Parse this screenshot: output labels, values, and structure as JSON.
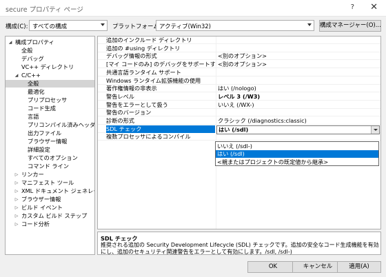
{
  "window": {
    "title": "secure プロパティ ページ",
    "help": "?",
    "close": "✕"
  },
  "toolbar": {
    "config_label": "構成(C):",
    "config_value": "すべての構成",
    "platform_label": "プラットフォーム(P):",
    "platform_value": "アクティブ(Win32)",
    "config_manager": "構成マネージャー(O)..."
  },
  "tree": [
    {
      "label": "構成プロパティ",
      "level": 0,
      "expander": "◢"
    },
    {
      "label": "全般",
      "level": 1
    },
    {
      "label": "デバッグ",
      "level": 1
    },
    {
      "label": "VC++ ディレクトリ",
      "level": 1
    },
    {
      "label": "C/C++",
      "level": 1,
      "expander": "◢"
    },
    {
      "label": "全般",
      "level": 2,
      "selected": true
    },
    {
      "label": "最適化",
      "level": 2
    },
    {
      "label": "プリプロセッサ",
      "level": 2
    },
    {
      "label": "コード生成",
      "level": 2
    },
    {
      "label": "言語",
      "level": 2
    },
    {
      "label": "プリコンパイル済みヘッダー",
      "level": 2
    },
    {
      "label": "出力ファイル",
      "level": 2
    },
    {
      "label": "ブラウザー情報",
      "level": 2
    },
    {
      "label": "詳細設定",
      "level": 2
    },
    {
      "label": "すべてのオプション",
      "level": 2
    },
    {
      "label": "コマンド ライン",
      "level": 2
    },
    {
      "label": "リンカー",
      "level": 1,
      "expander": "▷"
    },
    {
      "label": "マニフェスト ツール",
      "level": 1,
      "expander": "▷"
    },
    {
      "label": "XML ドキュメント ジェネレーター",
      "level": 1,
      "expander": "▷"
    },
    {
      "label": "ブラウザー情報",
      "level": 1,
      "expander": "▷"
    },
    {
      "label": "ビルド イベント",
      "level": 1,
      "expander": "▷"
    },
    {
      "label": "カスタム ビルド ステップ",
      "level": 1,
      "expander": "▷"
    },
    {
      "label": "コード分析",
      "level": 1,
      "expander": "▷"
    }
  ],
  "properties": [
    {
      "name": "追加のインクルード ディレクトリ",
      "value": ""
    },
    {
      "name": "追加の #using ディレクトリ",
      "value": ""
    },
    {
      "name": "デバッグ情報の形式",
      "value": "<別のオプション>"
    },
    {
      "name": "[マイ コードのみ] のデバッグをサポートする",
      "value": "<別のオプション>"
    },
    {
      "name": "共通言語ランタイム サポート",
      "value": ""
    },
    {
      "name": "Windows ランタイム拡張機能の使用",
      "value": ""
    },
    {
      "name": "著作権情報の非表示",
      "value": "はい (/nologo)"
    },
    {
      "name": "警告レベル",
      "value": "レベル 3 (/W3)",
      "bold": true
    },
    {
      "name": "警告をエラーとして扱う",
      "value": "いいえ (/WX-)"
    },
    {
      "name": "警告のバージョン",
      "value": ""
    },
    {
      "name": "診断の形式",
      "value": "クラシック (/diagnostics:classic)"
    },
    {
      "name": "SDL チェック",
      "value": "",
      "selected": true
    },
    {
      "name": "複数プロセッサによるコンパイル",
      "value": ""
    }
  ],
  "sdl_combo": {
    "value": "はい (/sdl)"
  },
  "dropdown": {
    "options": [
      {
        "label": "いいえ (/sdl-)"
      },
      {
        "label": "はい (/sdl)",
        "highlighted": true
      },
      {
        "label": "<親またはプロジェクトの既定値から継承>"
      }
    ]
  },
  "description": {
    "title": "SDL チェック",
    "text": "推奨される追加の Security Development Lifecycle (SDL) チェックです。追加の安全なコード生成機能を有効にし、追加のセキュリティ関連警告をエラーとして有効にします。/sdl, /sdl-)"
  },
  "footer": {
    "ok": "OK",
    "cancel": "キャンセル",
    "apply": "適用(A)"
  },
  "colors": {
    "accent": "#0078d7",
    "tree_selected": "#d4d4d4"
  }
}
